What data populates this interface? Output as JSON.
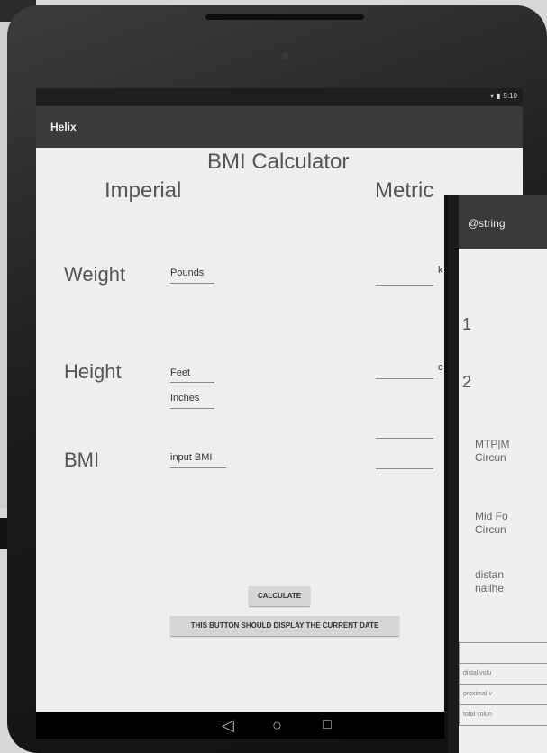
{
  "status_bar": {
    "time": "5:10"
  },
  "app_bar": {
    "title": "Helix"
  },
  "main": {
    "title": "BMI Calculator",
    "imperial_header": "Imperial",
    "metric_header": "Metric",
    "weight_label": "Weight",
    "height_label": "Height",
    "bmi_label": "BMI",
    "pounds_placeholder": "Pounds",
    "feet_placeholder": "Feet",
    "inches_placeholder": "Inches",
    "bmi_placeholder": "input BMI",
    "metric_weight_unit_partial": "k",
    "metric_height_unit_partial": "c",
    "calculate_button": "CALCULATE",
    "date_button": "THIS BUTTON SHOULD DISPLAY THE CURRENT DATE"
  },
  "second_window": {
    "title_partial": "@string",
    "row_1": "1",
    "row_2": "2",
    "mtp_label_line1": "MTP|M",
    "mtp_label_line2": "Circun",
    "midfoot_line1": "Mid Fo",
    "midfoot_line2": "Circun",
    "distance_line1": "distan",
    "distance_line2": "nailhe",
    "table_rows": [
      "distal volu",
      "proximal v",
      "total volun"
    ]
  },
  "navigation": {
    "back": "◁",
    "home": "○",
    "recents": "□"
  }
}
